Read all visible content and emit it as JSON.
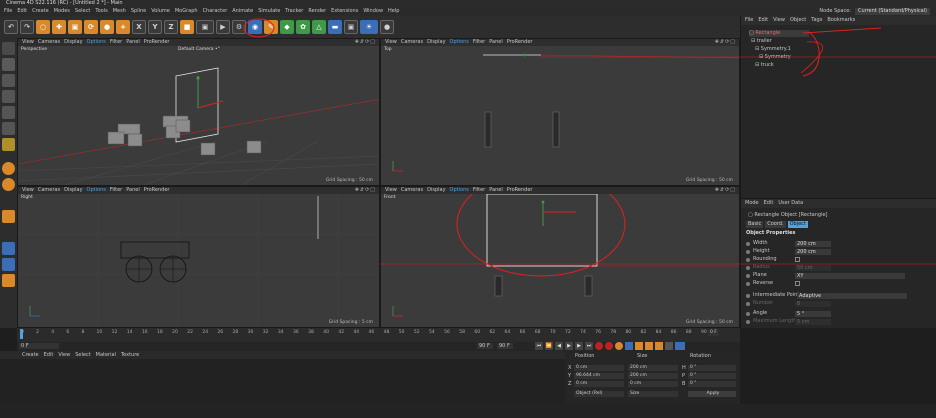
{
  "title": "Cinema 4D S22.116 (RC) - [Untitled 2 *] - Main",
  "menu": [
    "File",
    "Edit",
    "Create",
    "Modes",
    "Select",
    "Tools",
    "Mesh",
    "Spline",
    "Volume",
    "MoGraph",
    "Character",
    "Animate",
    "Simulate",
    "Tracker",
    "Render",
    "Extensions",
    "Window",
    "Help"
  ],
  "node_space": {
    "label": "Node Space:",
    "value": "Current (Standard/Physical)"
  },
  "toolbar": {
    "x": "X",
    "y": "Y",
    "z": "Z"
  },
  "viewports": {
    "perspective": {
      "name": "Perspective",
      "camera": "Default Camera •°",
      "menu": [
        "View",
        "Cameras",
        "Display",
        "Options",
        "Filter",
        "Panel",
        "ProRender"
      ],
      "grid": "Grid Spacing : 50 cm"
    },
    "top": {
      "name": "Top",
      "menu": [
        "View",
        "Cameras",
        "Display",
        "Options",
        "Filter",
        "Panel",
        "ProRender"
      ],
      "grid": "Grid Spacing : 50 cm"
    },
    "right": {
      "name": "Right",
      "menu": [
        "View",
        "Cameras",
        "Display",
        "Options",
        "Filter",
        "Panel",
        "ProRender"
      ],
      "grid": "Grid Spacing : 5 cm"
    },
    "front": {
      "name": "Front",
      "menu": [
        "View",
        "Cameras",
        "Display",
        "Options",
        "Filter",
        "Panel",
        "ProRender"
      ],
      "grid": "Grid Spacing : 50 cm"
    }
  },
  "objects": {
    "menu": [
      "File",
      "Edit",
      "View",
      "Object",
      "Tags",
      "Bookmarks"
    ],
    "items": [
      "Rectangle",
      "trailer",
      "Symmetry.1",
      "Symmetry",
      "truck"
    ]
  },
  "attributes": {
    "menu": [
      "Mode",
      "Edit",
      "User Data"
    ],
    "object_title": "Rectangle Object [Rectangle]",
    "tabs": [
      "Basic",
      "Coord.",
      "Object"
    ],
    "section": "Object Properties",
    "rows": [
      {
        "label": "Width",
        "value": "200 cm"
      },
      {
        "label": "Height",
        "value": "200 cm"
      },
      {
        "label": "Rounding",
        "value": ""
      },
      {
        "label": "Radius",
        "value": "50 cm"
      },
      {
        "label": "Plane",
        "value": "XY"
      },
      {
        "label": "Reverse",
        "value": ""
      },
      {
        "label": "Intermediate Points",
        "value": "Adaptive"
      },
      {
        "label": "Number",
        "value": "8"
      },
      {
        "label": "Angle",
        "value": "5 °"
      },
      {
        "label": "Maximum Length",
        "value": "5 cm"
      }
    ]
  },
  "timeline": {
    "ticks": [
      "0",
      "2",
      "4",
      "6",
      "8",
      "10",
      "12",
      "14",
      "16",
      "18",
      "20",
      "22",
      "24",
      "26",
      "28",
      "30",
      "32",
      "34",
      "36",
      "38",
      "40",
      "42",
      "44",
      "46",
      "48",
      "50",
      "52",
      "54",
      "56",
      "58",
      "60",
      "62",
      "64",
      "66",
      "68",
      "70",
      "72",
      "74",
      "76",
      "78",
      "80",
      "82",
      "84",
      "86",
      "88",
      "90"
    ],
    "current": "0 F",
    "start": "0 F",
    "end": "90 F",
    "end2": "90 F"
  },
  "material": {
    "menu": [
      "Create",
      "Edit",
      "View",
      "Select",
      "Material",
      "Texture"
    ]
  },
  "coords": {
    "headers": [
      "Position",
      "Size",
      "Rotation"
    ],
    "rows": [
      {
        "axis": "X",
        "pos": "0 cm",
        "size": "200 cm",
        "rot_axis": "H",
        "rot": "0 °"
      },
      {
        "axis": "Y",
        "pos": "96.644 cm",
        "size": "200 cm",
        "rot_axis": "P",
        "rot": "0 °"
      },
      {
        "axis": "Z",
        "pos": "0 cm",
        "size": "0 cm",
        "rot_axis": "B",
        "rot": "0 °"
      }
    ],
    "mode": "Object (Rel)",
    "size_mode": "Size",
    "apply": "Apply"
  },
  "colors": {
    "annotation": "#e0201e",
    "accent": "#4ea3e0",
    "orange": "#d9892b"
  }
}
